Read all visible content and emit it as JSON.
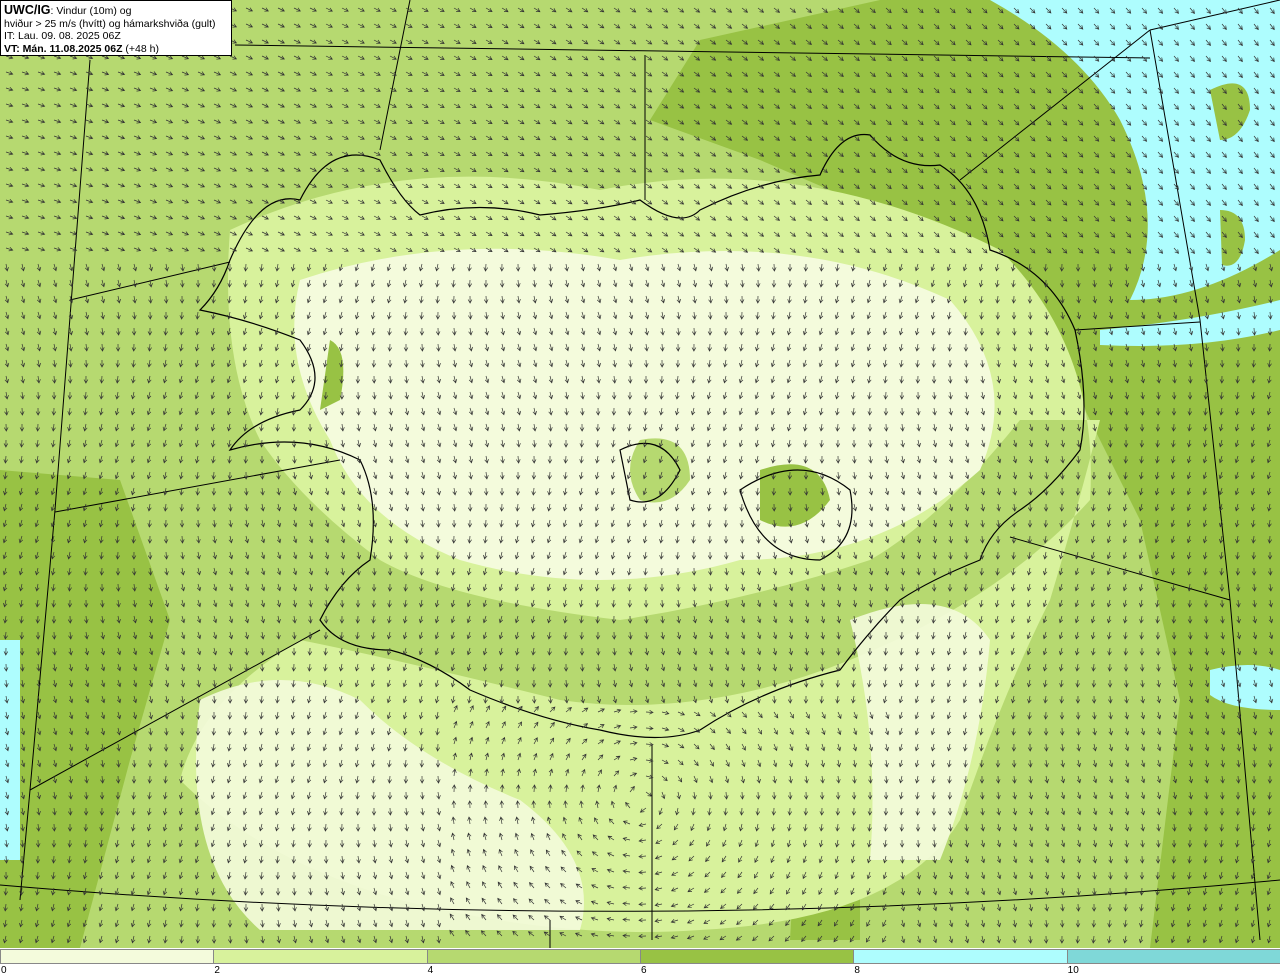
{
  "title": {
    "model": "UWC/IG",
    "line1_rest": ": Vindur (10m) og",
    "line2": "hviður > 25 m/s (hvítt) og hámarkshviða (gult)",
    "line3": "IT: Lau. 09. 08. 2025 06Z",
    "vt_label": "VT: Mán. 11.08.2025 06Z",
    "vt_offset": " (+48 h)"
  },
  "legend": {
    "colors": [
      "#f4fbdc",
      "#d8f29c",
      "#b6d970",
      "#98c244",
      "#aefdfe",
      "#7fd8d8"
    ],
    "ticks": [
      "0",
      "2",
      "4",
      "6",
      "8",
      "10"
    ]
  },
  "map": {
    "background_color": "#b6d970",
    "arrow_color": "#333333"
  }
}
